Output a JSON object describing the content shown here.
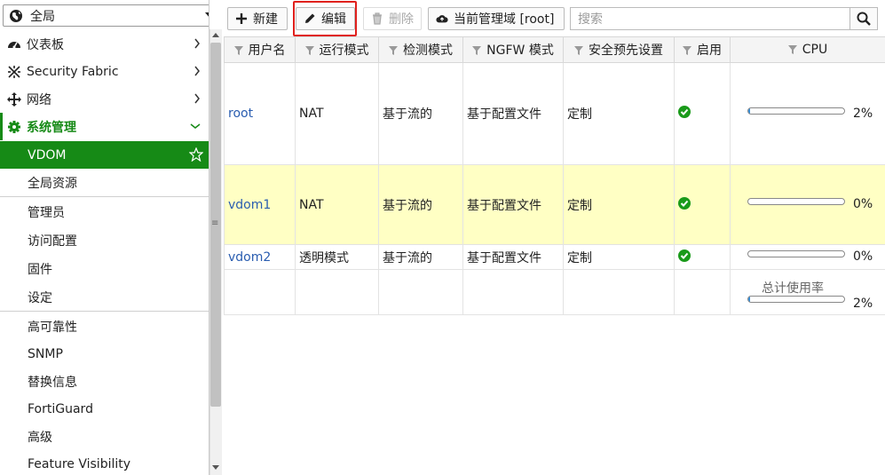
{
  "sidebar": {
    "vdom_selector": "全局",
    "items": [
      {
        "label": "仪表板",
        "icon": "dashboard-icon"
      },
      {
        "label": "Security Fabric",
        "icon": "fabric-icon"
      },
      {
        "label": "网络",
        "icon": "network-icon"
      },
      {
        "label": "系统管理",
        "icon": "gear-icon"
      }
    ],
    "sub_items": [
      "VDOM",
      "全局资源",
      "管理员",
      "访问配置",
      "固件",
      "设定",
      "高可靠性",
      "SNMP",
      "替换信息",
      "FortiGuard",
      "高级",
      "Feature Visibility"
    ],
    "active_color": "#168a16"
  },
  "toolbar": {
    "new_label": "新建",
    "edit_label": "编辑",
    "delete_label": "删除",
    "current_domain_label": "当前管理域 [root]",
    "search_placeholder": "搜索"
  },
  "table": {
    "headers": [
      "用户名",
      "运行模式",
      "检测模式",
      "NGFW 模式",
      "安全预先设置",
      "启用",
      "CPU"
    ],
    "rows": [
      {
        "name": "root",
        "mode": "NAT",
        "inspection": "基于流的",
        "ngfw": "基于配置文件",
        "profile": "定制",
        "enabled": true,
        "cpu": "2%",
        "cpu_value": 0.02
      },
      {
        "name": "vdom1",
        "mode": "NAT",
        "inspection": "基于流的",
        "ngfw": "基于配置文件",
        "profile": "定制",
        "enabled": true,
        "cpu": "0%",
        "cpu_value": 0.0
      },
      {
        "name": "vdom2",
        "mode": "透明模式",
        "inspection": "基于流的",
        "ngfw": "基于配置文件",
        "profile": "定制",
        "enabled": true,
        "cpu": "0%",
        "cpu_value": 0.0
      }
    ],
    "total_label": "总计使用率",
    "total_cpu": "2%",
    "total_cpu_value": 0.02,
    "highlight_color": "#ffffc4",
    "enabled_color": "#1a9a1a"
  }
}
